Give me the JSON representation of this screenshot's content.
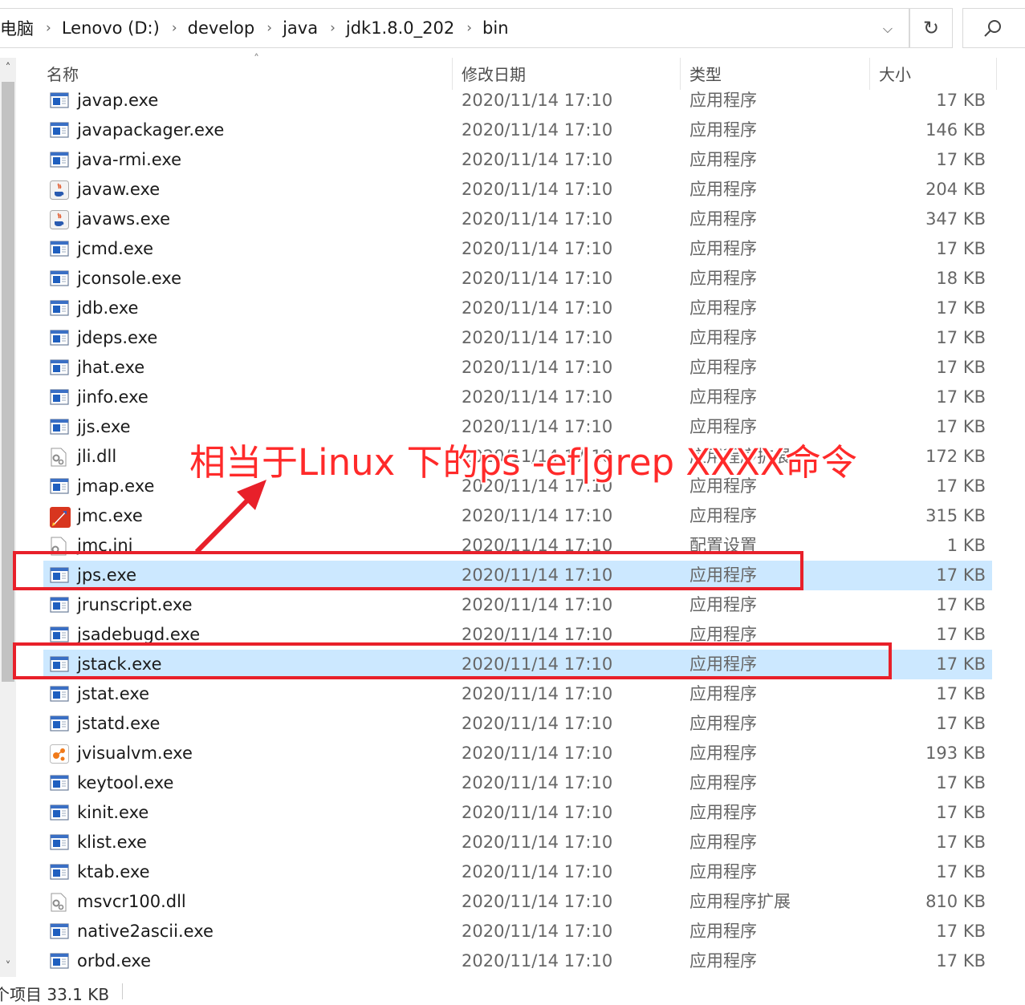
{
  "breadcrumb": [
    "电脑",
    "Lenovo (D:)",
    "develop",
    "java",
    "jdk1.8.0_202",
    "bin"
  ],
  "columns": {
    "name": "名称",
    "date": "修改日期",
    "type": "类型",
    "size": "大小"
  },
  "files": [
    {
      "name": "javap.exe",
      "date": "2020/11/14 17:10",
      "type": "应用程序",
      "size": "17 KB",
      "icon": "app-window-icon"
    },
    {
      "name": "javapackager.exe",
      "date": "2020/11/14 17:10",
      "type": "应用程序",
      "size": "146 KB",
      "icon": "app-window-icon"
    },
    {
      "name": "java-rmi.exe",
      "date": "2020/11/14 17:10",
      "type": "应用程序",
      "size": "17 KB",
      "icon": "app-window-icon"
    },
    {
      "name": "javaw.exe",
      "date": "2020/11/14 17:10",
      "type": "应用程序",
      "size": "204 KB",
      "icon": "java-cup-icon"
    },
    {
      "name": "javaws.exe",
      "date": "2020/11/14 17:10",
      "type": "应用程序",
      "size": "347 KB",
      "icon": "java-cup-icon"
    },
    {
      "name": "jcmd.exe",
      "date": "2020/11/14 17:10",
      "type": "应用程序",
      "size": "17 KB",
      "icon": "app-window-icon"
    },
    {
      "name": "jconsole.exe",
      "date": "2020/11/14 17:10",
      "type": "应用程序",
      "size": "18 KB",
      "icon": "app-window-icon"
    },
    {
      "name": "jdb.exe",
      "date": "2020/11/14 17:10",
      "type": "应用程序",
      "size": "17 KB",
      "icon": "app-window-icon"
    },
    {
      "name": "jdeps.exe",
      "date": "2020/11/14 17:10",
      "type": "应用程序",
      "size": "17 KB",
      "icon": "app-window-icon"
    },
    {
      "name": "jhat.exe",
      "date": "2020/11/14 17:10",
      "type": "应用程序",
      "size": "17 KB",
      "icon": "app-window-icon"
    },
    {
      "name": "jinfo.exe",
      "date": "2020/11/14 17:10",
      "type": "应用程序",
      "size": "17 KB",
      "icon": "app-window-icon"
    },
    {
      "name": "jjs.exe",
      "date": "2020/11/14 17:10",
      "type": "应用程序",
      "size": "17 KB",
      "icon": "app-window-icon"
    },
    {
      "name": "jli.dll",
      "date": "2020/11/14 17:10",
      "type": "应用程序扩展",
      "size": "172 KB",
      "icon": "dll-gear-icon"
    },
    {
      "name": "jmap.exe",
      "date": "2020/11/14 17:10",
      "type": "应用程序",
      "size": "17 KB",
      "icon": "app-window-icon"
    },
    {
      "name": "jmc.exe",
      "date": "2020/11/14 17:10",
      "type": "应用程序",
      "size": "315 KB",
      "icon": "rocket-icon"
    },
    {
      "name": "jmc.ini",
      "date": "2020/11/14 17:10",
      "type": "配置设置",
      "size": "1 KB",
      "icon": "config-file-icon"
    },
    {
      "name": "jps.exe",
      "date": "2020/11/14 17:10",
      "type": "应用程序",
      "size": "17 KB",
      "icon": "app-window-icon",
      "selected": true
    },
    {
      "name": "jrunscript.exe",
      "date": "2020/11/14 17:10",
      "type": "应用程序",
      "size": "17 KB",
      "icon": "app-window-icon"
    },
    {
      "name": "jsadebugd.exe",
      "date": "2020/11/14 17:10",
      "type": "应用程序",
      "size": "17 KB",
      "icon": "app-window-icon"
    },
    {
      "name": "jstack.exe",
      "date": "2020/11/14 17:10",
      "type": "应用程序",
      "size": "17 KB",
      "icon": "app-window-icon",
      "selected": true
    },
    {
      "name": "jstat.exe",
      "date": "2020/11/14 17:10",
      "type": "应用程序",
      "size": "17 KB",
      "icon": "app-window-icon"
    },
    {
      "name": "jstatd.exe",
      "date": "2020/11/14 17:10",
      "type": "应用程序",
      "size": "17 KB",
      "icon": "app-window-icon"
    },
    {
      "name": "jvisualvm.exe",
      "date": "2020/11/14 17:10",
      "type": "应用程序",
      "size": "193 KB",
      "icon": "visualvm-icon"
    },
    {
      "name": "keytool.exe",
      "date": "2020/11/14 17:10",
      "type": "应用程序",
      "size": "17 KB",
      "icon": "app-window-icon"
    },
    {
      "name": "kinit.exe",
      "date": "2020/11/14 17:10",
      "type": "应用程序",
      "size": "17 KB",
      "icon": "app-window-icon"
    },
    {
      "name": "klist.exe",
      "date": "2020/11/14 17:10",
      "type": "应用程序",
      "size": "17 KB",
      "icon": "app-window-icon"
    },
    {
      "name": "ktab.exe",
      "date": "2020/11/14 17:10",
      "type": "应用程序",
      "size": "17 KB",
      "icon": "app-window-icon"
    },
    {
      "name": "msvcr100.dll",
      "date": "2020/11/14 17:10",
      "type": "应用程序扩展",
      "size": "810 KB",
      "icon": "dll-gear-icon"
    },
    {
      "name": "native2ascii.exe",
      "date": "2020/11/14 17:10",
      "type": "应用程序",
      "size": "17 KB",
      "icon": "app-window-icon"
    },
    {
      "name": "orbd.exe",
      "date": "2020/11/14 17:10",
      "type": "应用程序",
      "size": "17 KB",
      "icon": "app-window-icon"
    }
  ],
  "status": {
    "text": "个项目  33.1 KB"
  },
  "annotation": {
    "text": "相当于Linux 下的ps -ef|grep XXXX命令",
    "color": "#e8202a"
  },
  "colors": {
    "selected_row": "#cce8ff",
    "annotation_red": "#e8202a"
  }
}
